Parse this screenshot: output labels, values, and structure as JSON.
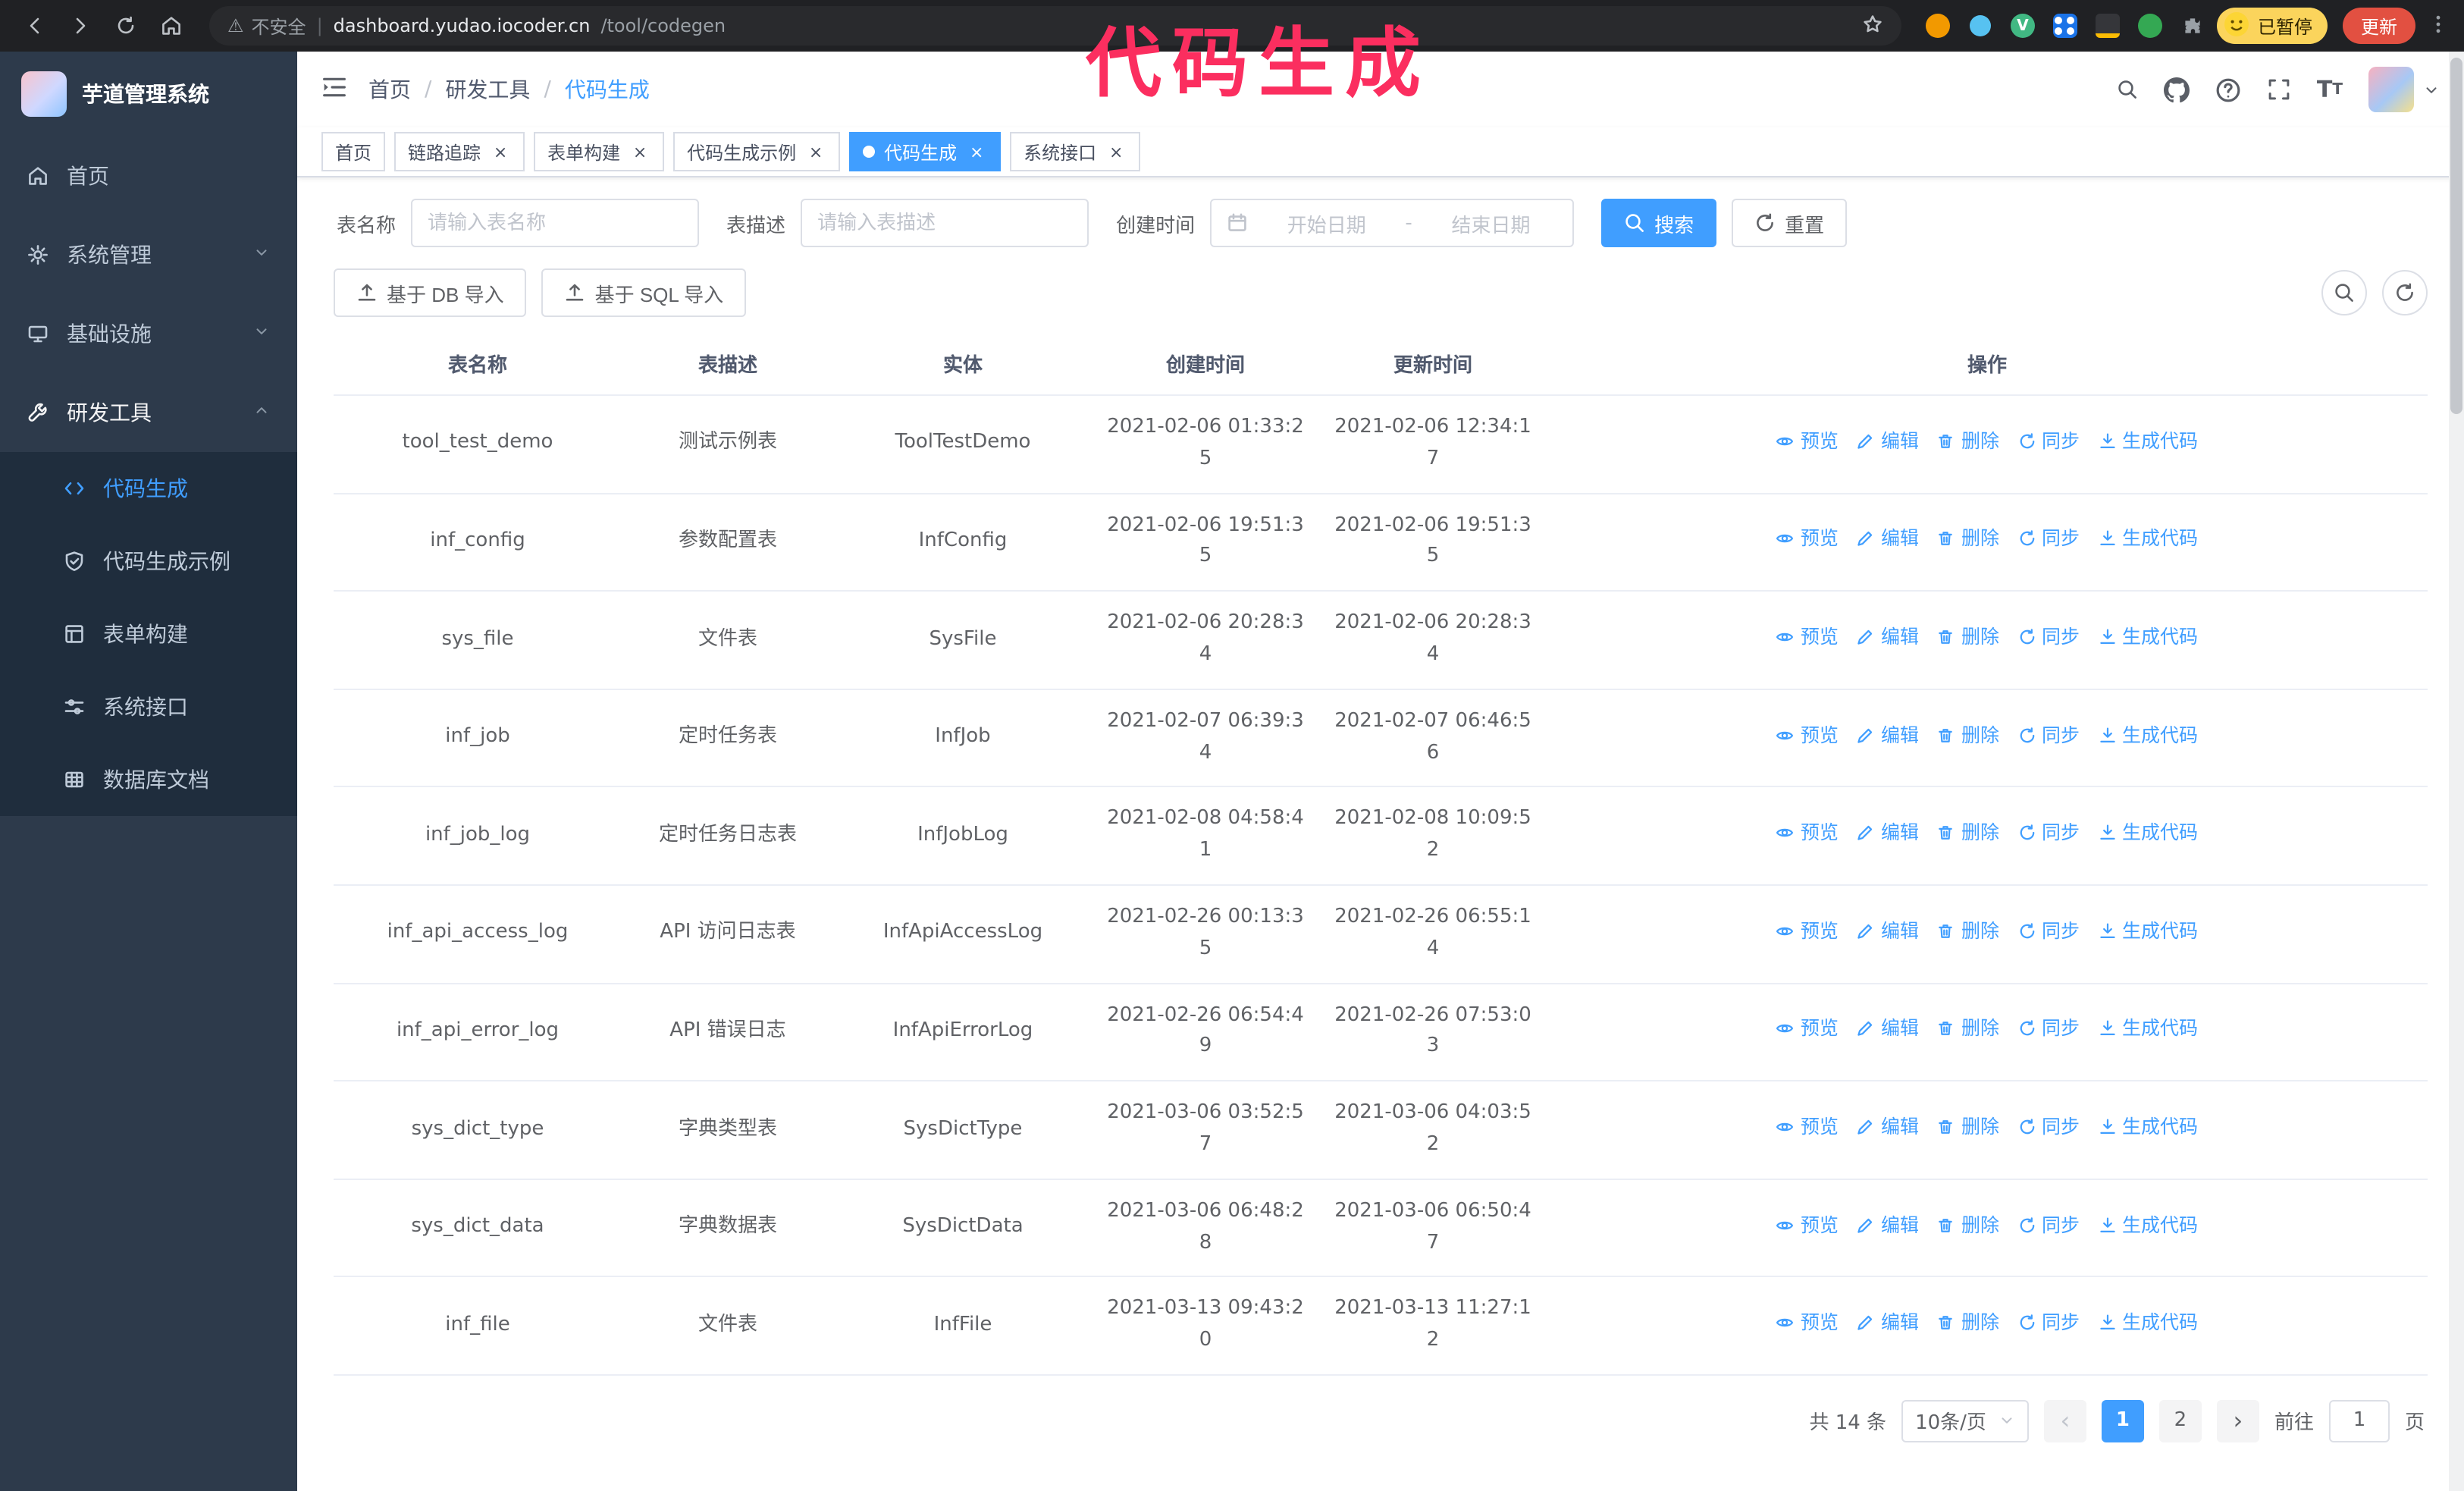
{
  "annotation": {
    "text": "代码生成"
  },
  "colors": {
    "accent": "#409eff",
    "annotation_pink": "#fb2e5f",
    "sidebar_bg": "#2d3a4b",
    "submenu_bg": "#1f2d3d",
    "chrome_bg": "#202124",
    "update_button": "#e25041",
    "profile_badge": "#fbd45c"
  },
  "browser": {
    "security_label": "不安全",
    "url_domain": "dashboard.yudao.iocoder.cn",
    "url_path": "/tool/codegen",
    "extension_v_label": "V",
    "profile_label": "已暂停",
    "update_label": "更新"
  },
  "sidebar": {
    "logo_title": "芋道管理系统",
    "items": [
      {
        "label": "首页",
        "icon": "home"
      },
      {
        "label": "系统管理",
        "icon": "gear",
        "expandable": true
      },
      {
        "label": "基础设施",
        "icon": "infra",
        "expandable": true
      },
      {
        "label": "研发工具",
        "icon": "tools",
        "expanded": true
      }
    ],
    "subitems": [
      {
        "label": "代码生成",
        "icon": "code",
        "active": true
      },
      {
        "label": "代码生成示例",
        "icon": "shield"
      },
      {
        "label": "表单构建",
        "icon": "form"
      },
      {
        "label": "系统接口",
        "icon": "api"
      },
      {
        "label": "数据库文档",
        "icon": "db"
      }
    ]
  },
  "header": {
    "breadcrumb": [
      "首页",
      "研发工具",
      "代码生成"
    ]
  },
  "tags": [
    {
      "label": "首页",
      "closable": false,
      "active": false
    },
    {
      "label": "链路追踪",
      "closable": true,
      "active": false
    },
    {
      "label": "表单构建",
      "closable": true,
      "active": false
    },
    {
      "label": "代码生成示例",
      "closable": true,
      "active": false
    },
    {
      "label": "代码生成",
      "closable": true,
      "active": true
    },
    {
      "label": "系统接口",
      "closable": true,
      "active": false
    }
  ],
  "filters": {
    "table_name_label": "表名称",
    "table_name_placeholder": "请输入表名称",
    "table_desc_label": "表描述",
    "table_desc_placeholder": "请输入表描述",
    "create_time_label": "创建时间",
    "date_start_placeholder": "开始日期",
    "date_separator": "-",
    "date_end_placeholder": "结束日期",
    "search_label": "搜索",
    "reset_label": "重置"
  },
  "toolbar": {
    "import_db_label": "基于 DB 导入",
    "import_sql_label": "基于 SQL 导入"
  },
  "table": {
    "columns": [
      "表名称",
      "表描述",
      "实体",
      "创建时间",
      "更新时间",
      "操作"
    ],
    "actions": [
      {
        "label": "预览",
        "icon": "eye"
      },
      {
        "label": "编辑",
        "icon": "edit"
      },
      {
        "label": "删除",
        "icon": "del"
      },
      {
        "label": "同步",
        "icon": "sync"
      },
      {
        "label": "生成代码",
        "icon": "download"
      }
    ],
    "rows": [
      {
        "name": "tool_test_demo",
        "desc": "测试示例表",
        "entity": "ToolTestDemo",
        "created": "2021-02-06 01:33:25",
        "updated": "2021-02-06 12:34:17"
      },
      {
        "name": "inf_config",
        "desc": "参数配置表",
        "entity": "InfConfig",
        "created": "2021-02-06 19:51:35",
        "updated": "2021-02-06 19:51:35"
      },
      {
        "name": "sys_file",
        "desc": "文件表",
        "entity": "SysFile",
        "created": "2021-02-06 20:28:34",
        "updated": "2021-02-06 20:28:34"
      },
      {
        "name": "inf_job",
        "desc": "定时任务表",
        "entity": "InfJob",
        "created": "2021-02-07 06:39:34",
        "updated": "2021-02-07 06:46:56"
      },
      {
        "name": "inf_job_log",
        "desc": "定时任务日志表",
        "entity": "InfJobLog",
        "created": "2021-02-08 04:58:41",
        "updated": "2021-02-08 10:09:52"
      },
      {
        "name": "inf_api_access_log",
        "desc": "API 访问日志表",
        "entity": "InfApiAccessLog",
        "created": "2021-02-26 00:13:35",
        "updated": "2021-02-26 06:55:14"
      },
      {
        "name": "inf_api_error_log",
        "desc": "API 错误日志",
        "entity": "InfApiErrorLog",
        "created": "2021-02-26 06:54:49",
        "updated": "2021-02-26 07:53:03"
      },
      {
        "name": "sys_dict_type",
        "desc": "字典类型表",
        "entity": "SysDictType",
        "created": "2021-03-06 03:52:57",
        "updated": "2021-03-06 04:03:52"
      },
      {
        "name": "sys_dict_data",
        "desc": "字典数据表",
        "entity": "SysDictData",
        "created": "2021-03-06 06:48:28",
        "updated": "2021-03-06 06:50:47"
      },
      {
        "name": "inf_file",
        "desc": "文件表",
        "entity": "InfFile",
        "created": "2021-03-13 09:43:20",
        "updated": "2021-03-13 11:27:12"
      }
    ]
  },
  "pagination": {
    "total_label": "共 14 条",
    "page_size_label": "10条/页",
    "pages": [
      "1",
      "2"
    ],
    "active_page": "1",
    "goto_label": "前往",
    "goto_value": "1",
    "goto_suffix": "页"
  }
}
